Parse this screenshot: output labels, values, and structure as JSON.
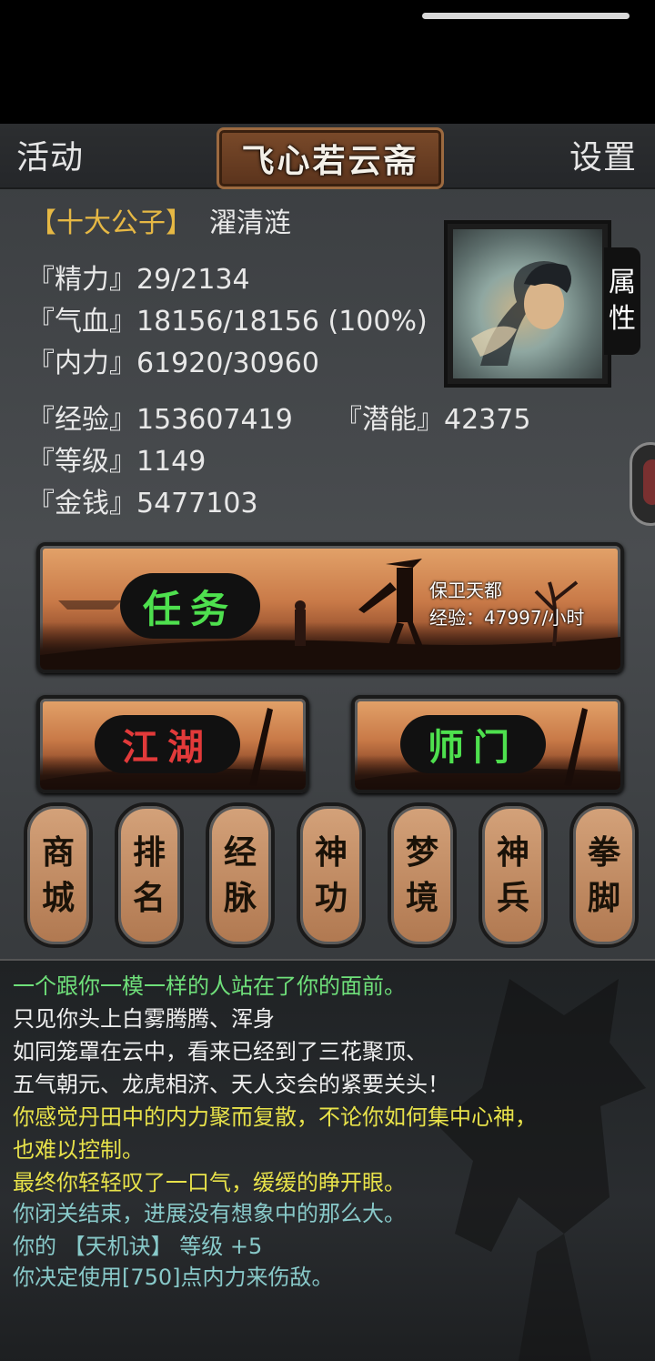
{
  "topbar": {
    "left": "活动",
    "title": "飞心若云斋",
    "right": "设置"
  },
  "profile": {
    "rank": "【十大公子】",
    "name": "濯清涟",
    "stats": {
      "energy_label": "『精力』",
      "energy": "29/2134",
      "hp_label": "『气血』",
      "hp": "18156/18156 (100%)",
      "inner_label": "『内力』",
      "inner": "61920/30960",
      "exp_label": "『经验』",
      "exp": "153607419",
      "potential_label": "『潜能』",
      "potential": "42375",
      "level_label": "『等级』",
      "level": "1149",
      "money_label": "『金钱』",
      "money": "5477103"
    },
    "attr_tab": [
      "属",
      "性"
    ]
  },
  "quest": {
    "label": "任务",
    "name": "保卫天都",
    "exp_rate": "经验：47997/小时"
  },
  "buttons": {
    "jianghu": "江湖",
    "shimen": "师门"
  },
  "menu": [
    {
      "c1": "商",
      "c2": "城"
    },
    {
      "c1": "排",
      "c2": "名"
    },
    {
      "c1": "经",
      "c2": "脉"
    },
    {
      "c1": "神",
      "c2": "功"
    },
    {
      "c1": "梦",
      "c2": "境"
    },
    {
      "c1": "神",
      "c2": "兵"
    },
    {
      "c1": "拳",
      "c2": "脚"
    }
  ],
  "log": [
    "一个跟你一模一样的人站在了你的面前。",
    "只见你头上白雾腾腾、浑身",
    "如同笼罩在云中，看来已经到了三花聚顶、",
    "五气朝元、龙虎相济、天人交会的紧要关头！",
    "你感觉丹田中的内力聚而复散，不论你如何集中心神，",
    "也难以控制。",
    "最终你轻轻叹了一口气，缓缓的睁开眼。",
    "你闭关结束，进展没有想象中的那么大。",
    "你的 【天机诀】 等级 +5",
    "你决定使用[750]点内力来伤敌。"
  ],
  "colors": {
    "green": "#6fe07a",
    "yellow": "#e8e24a",
    "teal": "#88c9c9",
    "jianghu_text": "#e23a3a",
    "shimen_text": "#4ee04e",
    "quest_text": "#4ee04e"
  }
}
